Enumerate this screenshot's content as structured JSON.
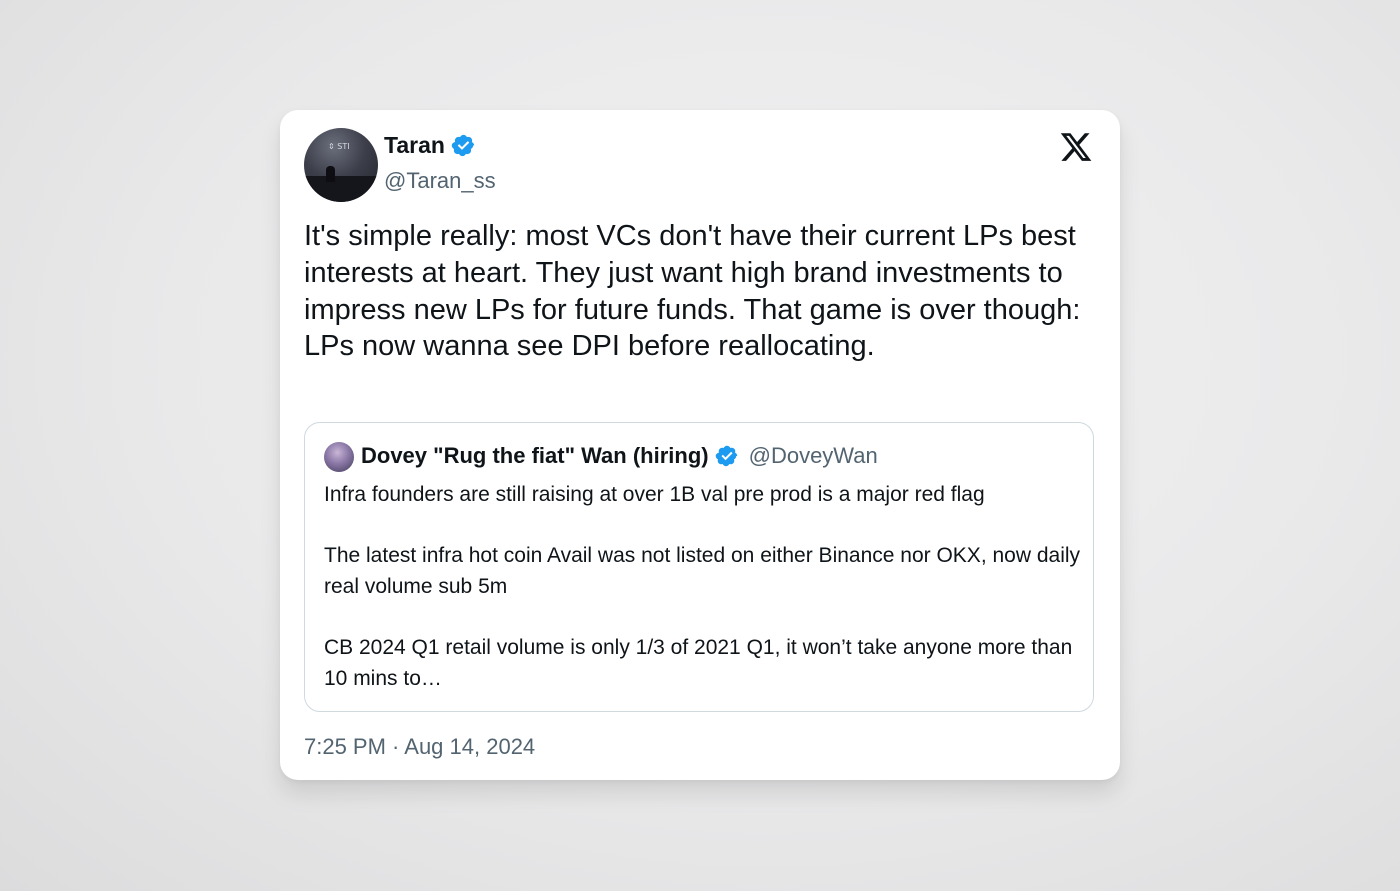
{
  "tweet": {
    "author": {
      "name": "Taran",
      "handle": "@Taran_ss",
      "avatar_mark": "⇕ STI",
      "verified": true
    },
    "text": "It's simple really: most VCs don't have their current LPs best interests at heart. They just want high brand investments to impress new LPs for future funds. That game is over though: LPs now wanna see DPI before reallocating.",
    "quoted": {
      "name": "Dovey \"Rug the fiat\" Wan (hiring)",
      "handle": "@DoveyWan",
      "verified": true,
      "paragraphs": [
        "Infra founders are still raising at over 1B val pre prod is a major red flag",
        "The latest infra hot coin Avail was not listed on either Binance nor OKX, now daily real volume sub 5m",
        "CB 2024 Q1 retail volume is only 1/3 of 2021 Q1, it won’t take anyone more than 10 mins to…"
      ]
    },
    "timestamp": "7:25 PM · Aug 14, 2024"
  },
  "icons": {
    "logo": "x-logo-icon",
    "verified": "verified-badge-icon"
  },
  "colors": {
    "verified_blue": "#1d9bf0",
    "text_primary": "#0f1419",
    "text_secondary": "#536471",
    "border": "#cfd9de"
  }
}
